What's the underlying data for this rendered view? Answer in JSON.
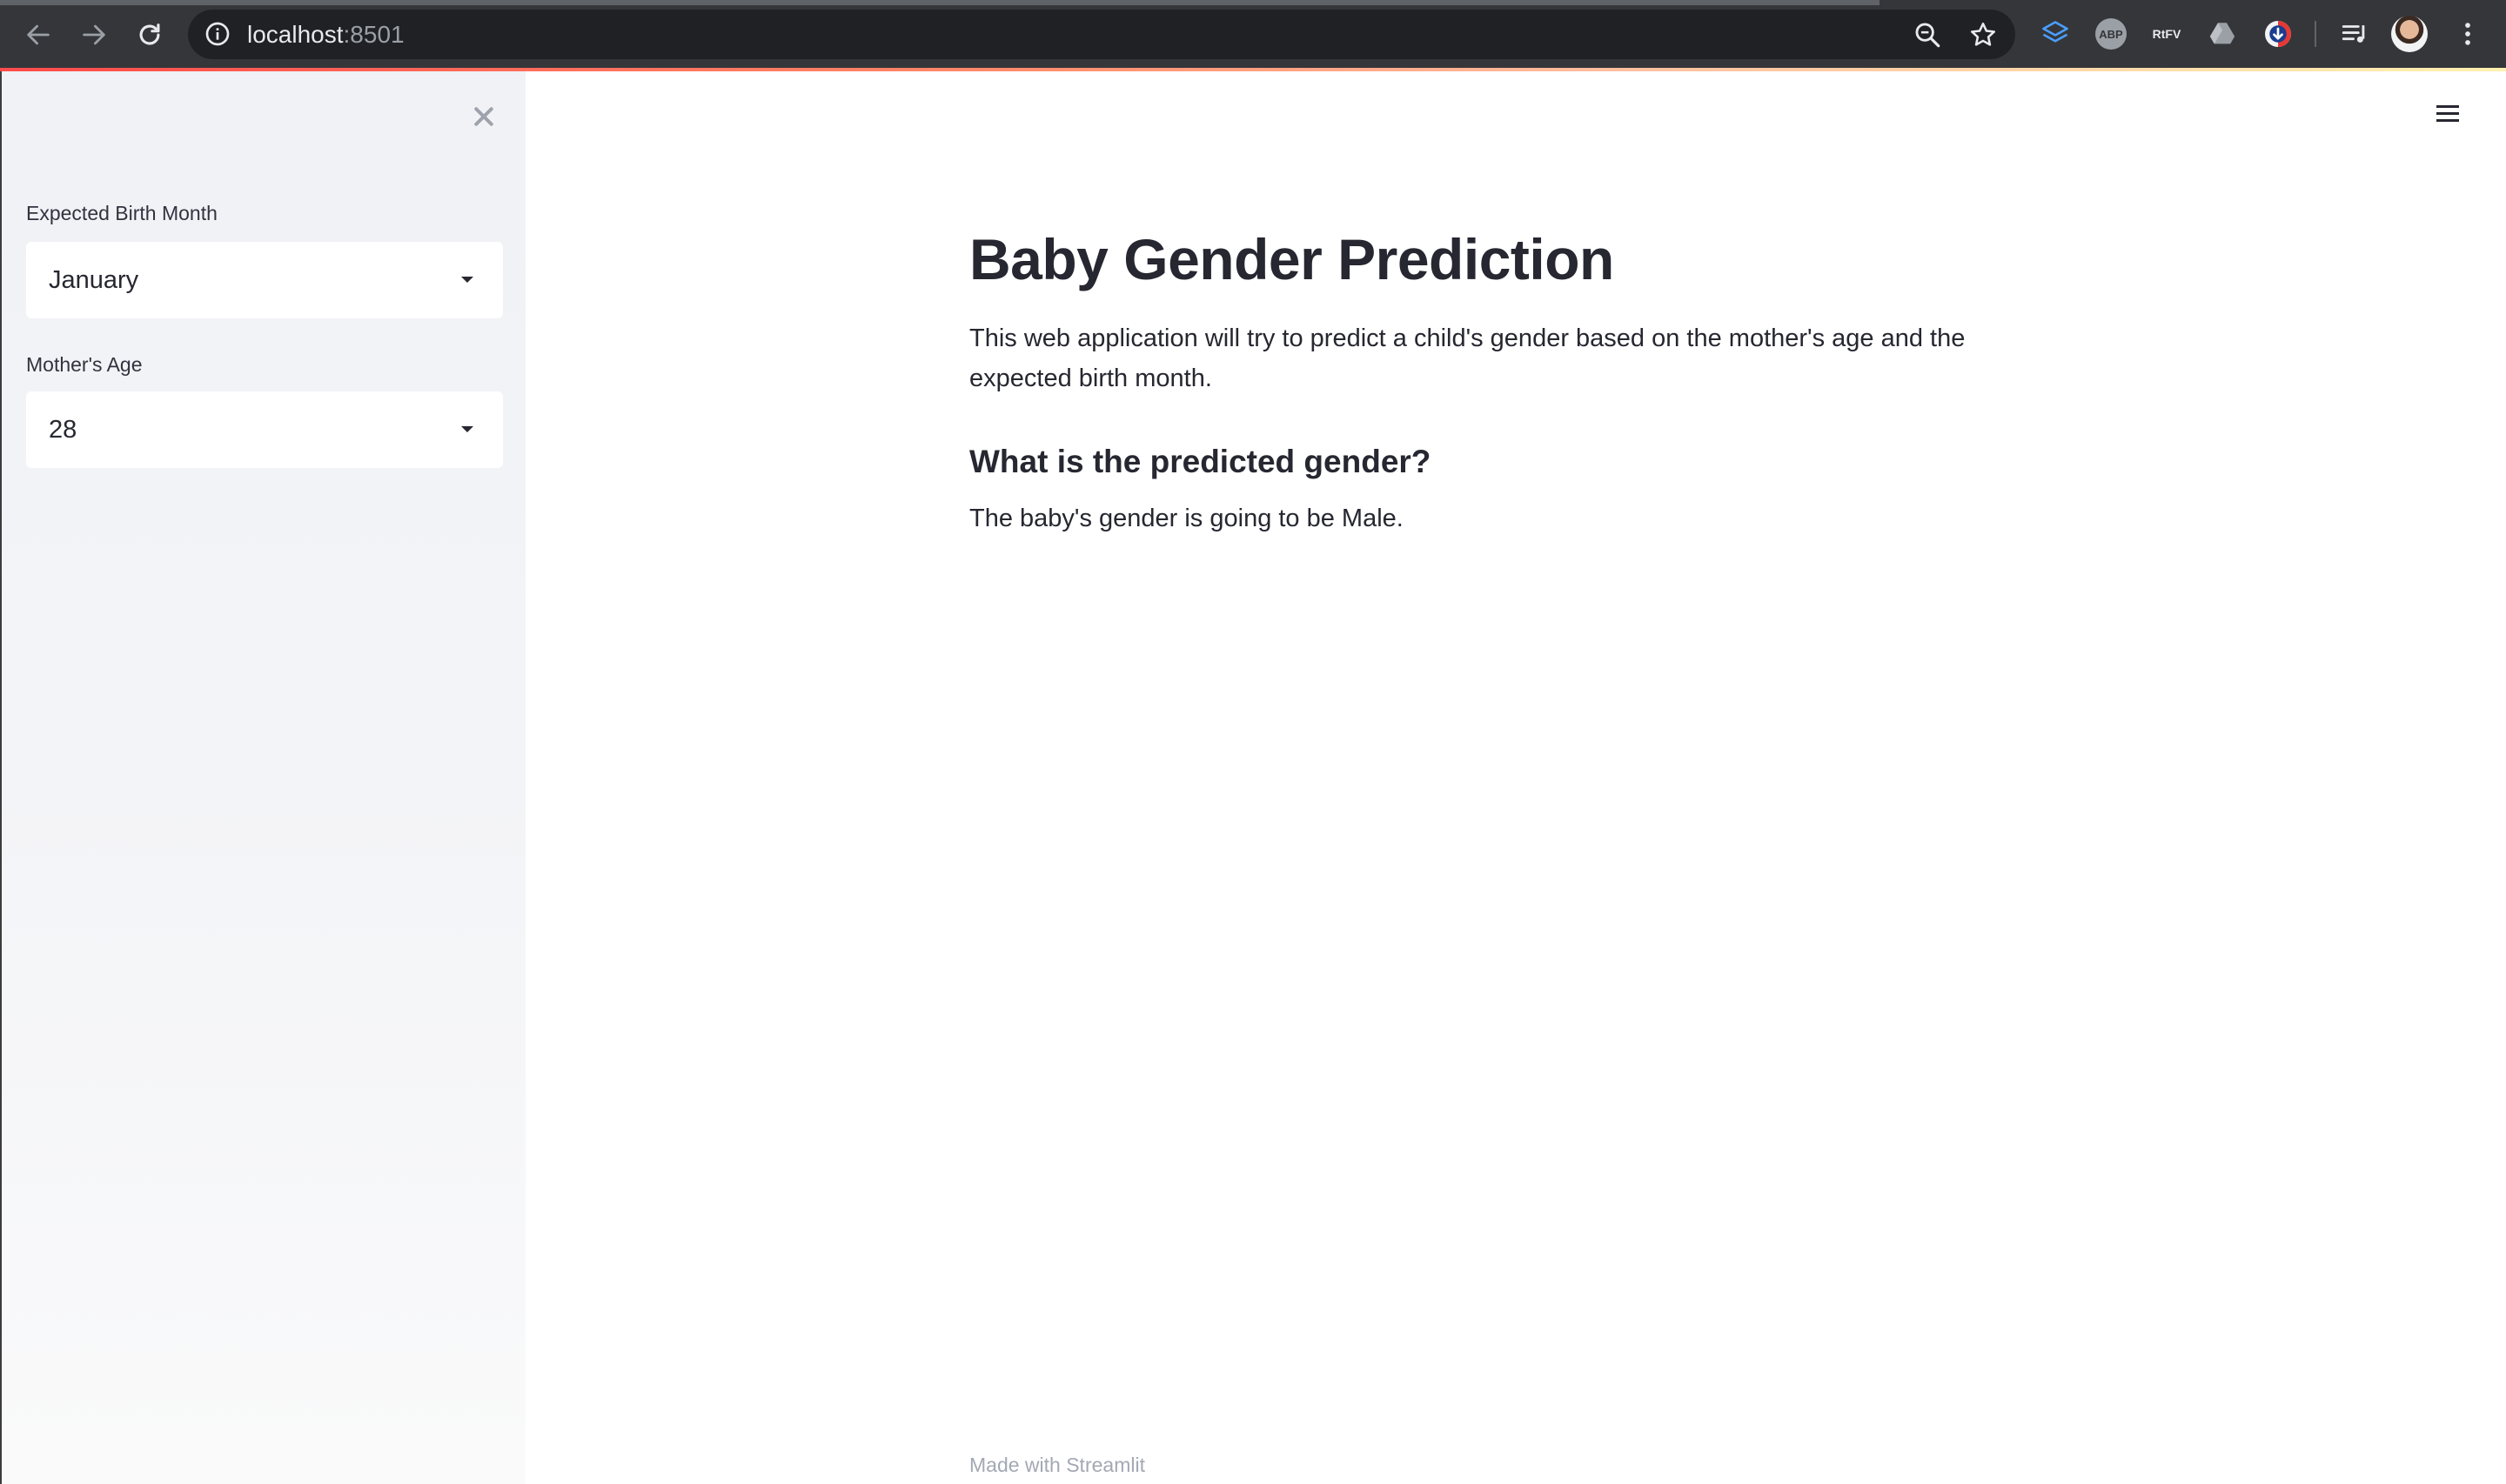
{
  "browser": {
    "url_host": "localhost",
    "url_port": ":8501",
    "extensions": {
      "abp_label": "ABP",
      "rtfv_label": "RtFV"
    },
    "icons": [
      "back-icon",
      "forward-icon",
      "reload-icon",
      "info-icon",
      "zoom-icon",
      "star-icon",
      "layers-icon",
      "drive-icon",
      "download-icon",
      "media-queue-icon",
      "kebab-menu-icon"
    ]
  },
  "sidebar": {
    "birth_month": {
      "label": "Expected Birth Month",
      "value": "January"
    },
    "mother_age": {
      "label": "Mother's Age",
      "value": "28"
    }
  },
  "main": {
    "title": "Baby Gender Prediction",
    "description": "This web application will try to predict a child's gender based on the mother's age and the expected birth month.",
    "subheading": "What is the predicted gender?",
    "prediction": "The baby's gender is going to be Male."
  },
  "footer": {
    "text": "Made with Streamlit"
  },
  "colors": {
    "chrome_bg": "#35363a",
    "sidebar_bg": "#f0f2f6",
    "text": "#262730",
    "accent_gradient_start": "#ff4b4b",
    "footer_text": "#a3a8b4"
  }
}
